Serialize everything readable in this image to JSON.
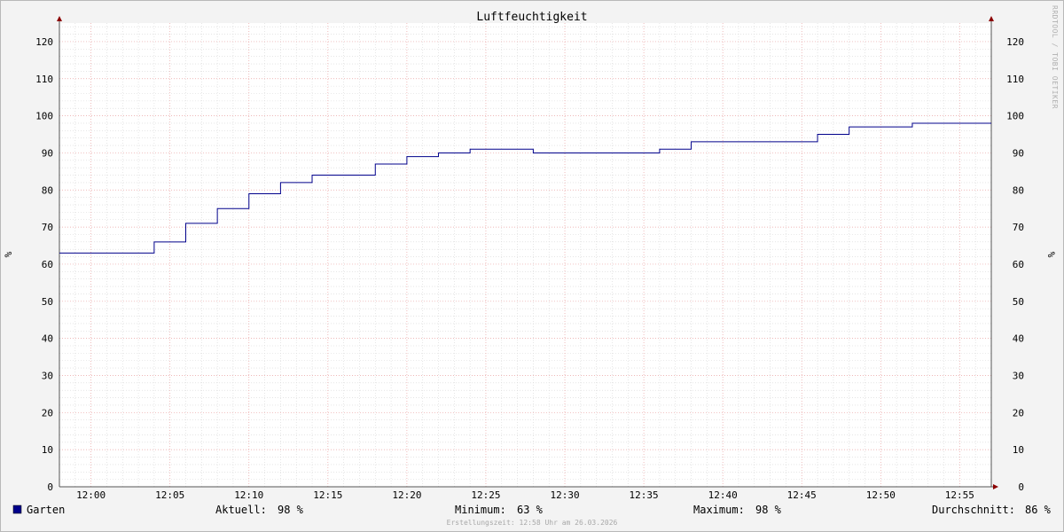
{
  "chart_data": {
    "type": "line",
    "title": "Luftfeuchtigkeit",
    "ylabel": "%",
    "ylabel_right": "%",
    "ylim": [
      0,
      125
    ],
    "yticks": [
      0,
      10,
      20,
      30,
      40,
      50,
      60,
      70,
      80,
      90,
      100,
      110,
      120
    ],
    "xlim_minutes": [
      "11:58",
      "12:57"
    ],
    "xticks": [
      "12:00",
      "12:05",
      "12:10",
      "12:15",
      "12:20",
      "12:25",
      "12:30",
      "12:35",
      "12:40",
      "12:45",
      "12:50",
      "12:55"
    ],
    "grid": true,
    "legend_position": "bottom",
    "watermark": "RRDTOOL / TOBI OETIKER",
    "series": [
      {
        "name": "Garten",
        "color": "#00008b",
        "step": true,
        "x": [
          "11:58",
          "12:04",
          "12:06",
          "12:08",
          "12:10",
          "12:12",
          "12:14",
          "12:18",
          "12:20",
          "12:22",
          "12:24",
          "12:28",
          "12:36",
          "12:38",
          "12:46",
          "12:48",
          "12:52",
          "12:57"
        ],
        "values": [
          63,
          66,
          71,
          75,
          79,
          82,
          84,
          87,
          89,
          90,
          91,
          90,
          91,
          93,
          95,
          97,
          98,
          98
        ]
      }
    ],
    "stats": {
      "current_label": "Aktuell:",
      "current_value": "98 %",
      "min_label": "Minimum:",
      "min_value": "63 %",
      "max_label": "Maximum:",
      "max_value": "98 %",
      "avg_label": "Durchschnitt:",
      "avg_value": "86 %"
    },
    "footer": "Erstellungszeit: 12:58 Uhr am 26.03.2026"
  },
  "colors": {
    "background": "#f3f3f3",
    "canvas": "#ffffff",
    "major_grid": "#e9a0a0",
    "minor_grid": "#d6d6d6",
    "axis": "#555555",
    "arrow": "#8b0000"
  }
}
